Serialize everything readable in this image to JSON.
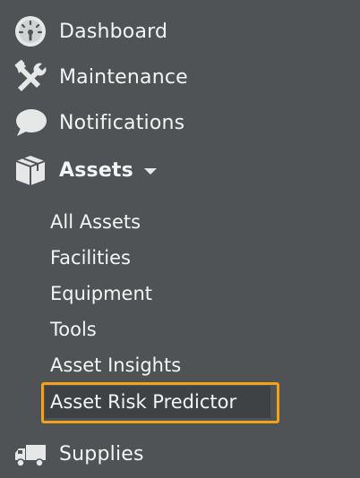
{
  "nav": {
    "items": [
      {
        "label": "Dashboard",
        "icon": "dashboard-gauge-icon"
      },
      {
        "label": "Maintenance",
        "icon": "tools-wrench-hammer-icon"
      },
      {
        "label": "Notifications",
        "icon": "speech-bubble-icon"
      },
      {
        "label": "Assets",
        "icon": "box-icon",
        "expanded": true
      },
      {
        "label": "Supplies",
        "icon": "truck-icon"
      }
    ],
    "assets_submenu": [
      {
        "label": "All Assets"
      },
      {
        "label": "Facilities"
      },
      {
        "label": "Equipment"
      },
      {
        "label": "Tools"
      },
      {
        "label": "Asset Insights"
      },
      {
        "label": "Asset Risk Predictor",
        "selected": true
      }
    ]
  },
  "colors": {
    "background": "#4f5355",
    "text": "#f4f5f5",
    "selected_bg": "#3e4244",
    "highlight_border": "#f0a21a"
  }
}
